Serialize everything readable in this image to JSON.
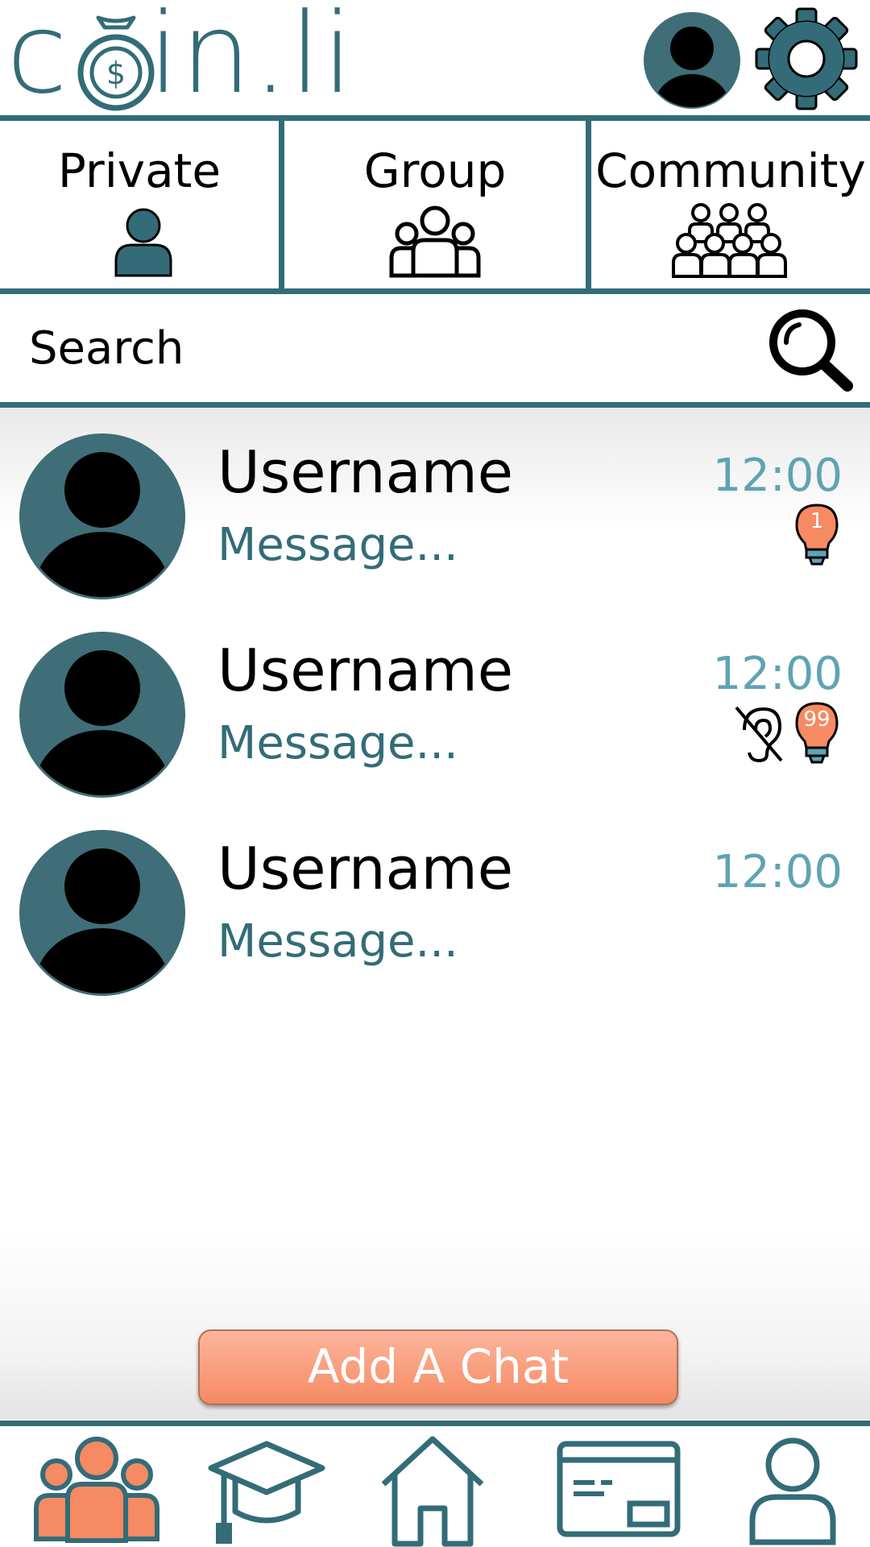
{
  "app": {
    "logo_text_left": "c",
    "logo_text_right": "in.li",
    "brand_color": "#336c78",
    "accent_color": "#f58a63",
    "time_color": "#5fa3b4"
  },
  "header": {
    "avatar_icon": "user-avatar-icon",
    "settings_icon": "gear-icon"
  },
  "tabs": [
    {
      "label": "Private",
      "icon": "single-person-icon"
    },
    {
      "label": "Group",
      "icon": "group-people-icon"
    },
    {
      "label": "Community",
      "icon": "community-crowd-icon"
    }
  ],
  "search": {
    "placeholder": "Search",
    "icon": "search-icon"
  },
  "chats": [
    {
      "username": "Username",
      "message": "Message...",
      "time": "12:00",
      "badge": "1",
      "muted": false
    },
    {
      "username": "Username",
      "message": "Message...",
      "time": "12:00",
      "badge": "99",
      "muted": true
    },
    {
      "username": "Username",
      "message": "Message...",
      "time": "12:00",
      "badge": "",
      "muted": false
    }
  ],
  "add_chat": {
    "label": "Add A Chat"
  },
  "bottom_nav": [
    {
      "icon": "chats-group-icon",
      "active": true
    },
    {
      "icon": "graduation-cap-icon",
      "active": false
    },
    {
      "icon": "home-icon",
      "active": false
    },
    {
      "icon": "card-icon",
      "active": false
    },
    {
      "icon": "profile-icon",
      "active": false
    }
  ]
}
